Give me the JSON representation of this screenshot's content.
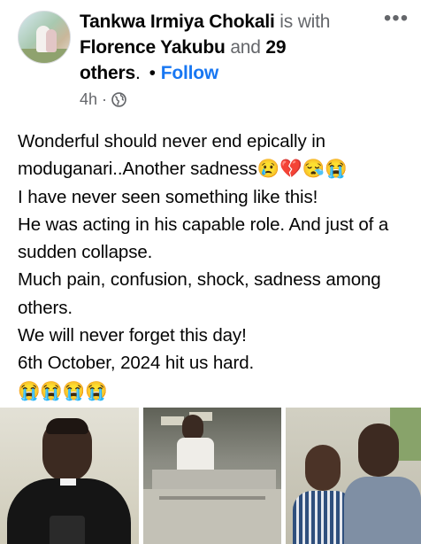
{
  "post": {
    "author": "Tankwa Irmiya Chokali",
    "with_text": " is with ",
    "tagged": "Florence Yakubu",
    "and_text": " and ",
    "others_count": "29",
    "others_label": "others",
    "period": ".",
    "separator": "•",
    "follow_label": "Follow",
    "more_label": "•••",
    "time": "4h",
    "meta_separator": "·",
    "privacy_icon": "globe-icon",
    "text": "Wonderful should never end epically in moduganari..Another sadness😢💔😪😭\nI have never seen something like this!\nHe was acting in his capable role. And just of a sudden collapse.\nMuch pain, confusion, shock, sadness among others.\nWe will never forget this day!\n6th October, 2024 hit us hard.\n😭😭😭😭"
  },
  "colors": {
    "link": "#1877f2",
    "muted": "#65676b",
    "text": "#050505"
  },
  "photos": [
    {
      "name": "photo-man-clerical-collar"
    },
    {
      "name": "photo-man-at-lectern"
    },
    {
      "name": "photo-two-men"
    }
  ]
}
